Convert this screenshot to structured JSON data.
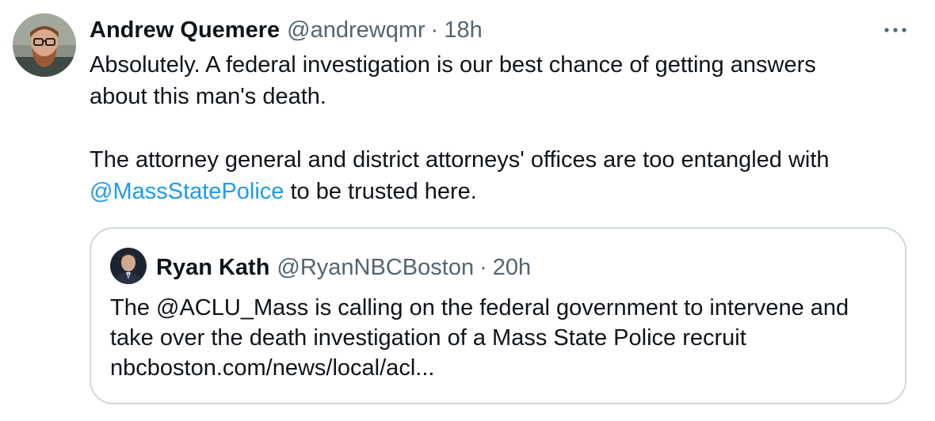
{
  "tweet": {
    "author_name": "Andrew Quemere",
    "handle": "@andrewqmr",
    "separator": "·",
    "time": "18h",
    "text_line1": "Absolutely. A federal investigation is our best chance of getting answers",
    "text_line2": "about this man's death.",
    "text_line3": "The attorney general and district attorneys' offices are too entangled with",
    "mention": "@MassStatePolice",
    "text_line4_rest": " to be trusted here.",
    "more_icon": "more-horizontal-icon"
  },
  "quote": {
    "author_name": "Ryan Kath",
    "handle": "@RyanNBCBoston",
    "separator": "·",
    "time": "20h",
    "text_line1": "The @ACLU_Mass is calling on the federal government to intervene and",
    "text_line2": "take over the death investigation of a Mass State Police recruit",
    "text_line3": "nbcboston.com/news/local/acl..."
  },
  "colors": {
    "text_primary": "#0f1419",
    "text_secondary": "#536471",
    "accent": "#1d9bf0",
    "border": "#cfd9de"
  }
}
